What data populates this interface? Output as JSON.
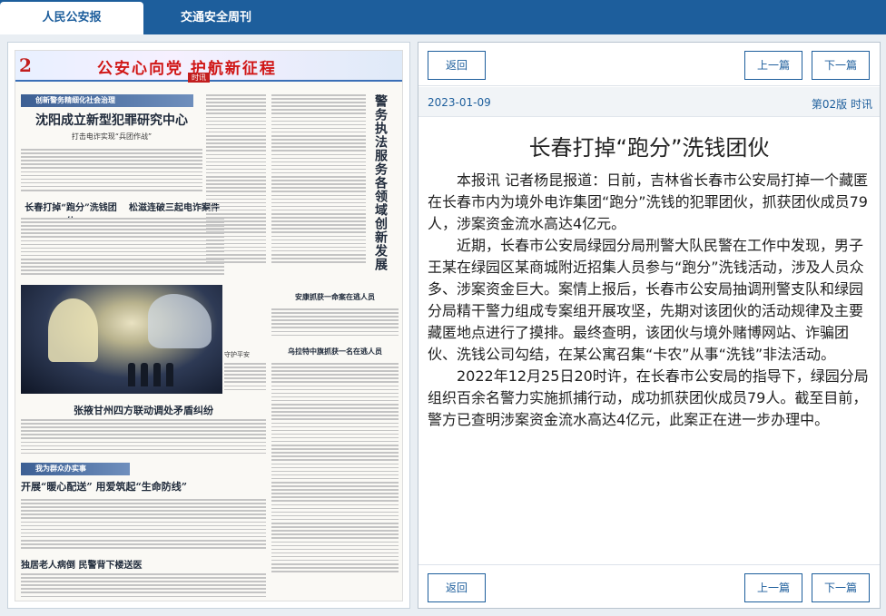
{
  "tabs": [
    {
      "label": "人民公安报",
      "active": true
    },
    {
      "label": "交通安全周刊",
      "active": false
    }
  ],
  "newspaper": {
    "page_no": "2",
    "masthead_title": "公安心向党 护航新征程",
    "masthead_sub": "时讯",
    "headlines": {
      "h1": "沈阳成立新型犯罪研究中心",
      "h1_sub": "打击电诈实现“兵团作战”",
      "h2": "长春打掉“跑分”洗钱团伙",
      "h3": "松滋连破三起电诈案件",
      "h4": "张掖甘州四方联动调处矛盾纠纷",
      "h5": "开展“暖心配送” 用爱筑起“生命防线”",
      "h6": "独居老人病倒 民警背下楼送医",
      "h7": "安康抓获一命案在逃人员",
      "h8": "乌拉特中旗抓获一名在逃人员",
      "vertical": "警务执法服务各领域创新发展"
    },
    "banner_top": "创新警务精细化社会治理",
    "banner_mid": "我为群众办实事",
    "caption": "守护平安"
  },
  "article": {
    "back_label": "返回",
    "prev_label": "上一篇",
    "next_label": "下一篇",
    "date": "2023-01-09",
    "page": "第02版 时讯",
    "title": "长春打掉“跑分”洗钱团伙",
    "paragraphs": [
      "本报讯 记者杨昆报道：日前，吉林省长春市公安局打掉一个藏匿在长春市内为境外电诈集团“跑分”洗钱的犯罪团伙，抓获团伙成员79人，涉案资金流水高达4亿元。",
      "近期，长春市公安局绿园分局刑警大队民警在工作中发现，男子王某在绿园区某商城附近招集人员参与“跑分”洗钱活动，涉及人员众多、涉案资金巨大。案情上报后，长春市公安局抽调刑警支队和绿园分局精干警力组成专案组开展攻坚，先期对该团伙的活动规律及主要藏匿地点进行了摸排。最终查明，该团伙与境外赌博网站、诈骗团伙、洗钱公司勾结，在某公寓召集“卡农”从事“洗钱”非法活动。",
      "2022年12月25日20时许，在长春市公安局的指导下，绿园分局组织百余名警力实施抓捕行动，成功抓获团伙成员79人。截至目前，警方已查明涉案资金流水高达4亿元，此案正在进一步办理中。"
    ]
  }
}
